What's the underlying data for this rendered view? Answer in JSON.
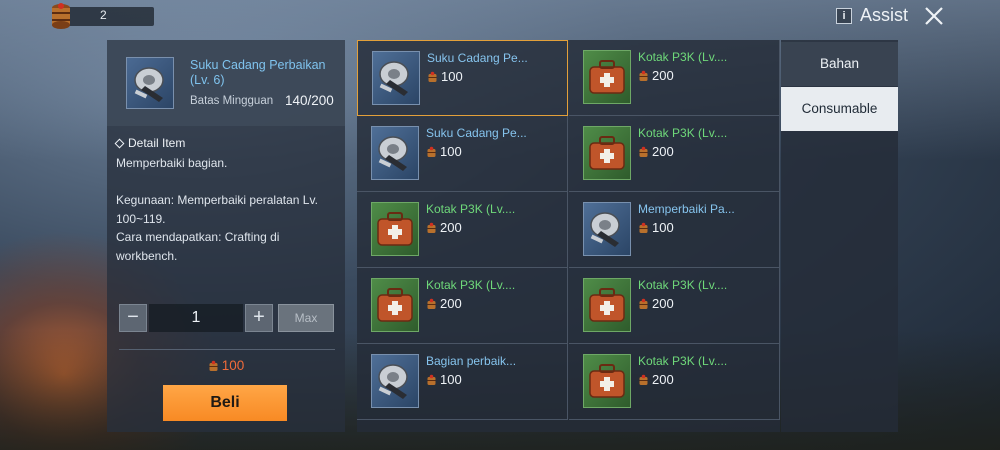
{
  "topbar": {
    "currency_count": "2",
    "currency_icon": "barrel-icon",
    "info_label": "i",
    "assist_label": "Assist",
    "close_icon": "close-icon"
  },
  "detail": {
    "item_name": "Suku Cadang Perbaikan (Lv. 6)",
    "limit_label": "Batas Mingguan",
    "limit_value": "140/200",
    "title": "Detail Item",
    "line1": "Memperbaiki bagian.",
    "line2": "Kegunaan: Memperbaiki peralatan Lv. 100~119.",
    "line3": "Cara mendapatkan: Crafting di workbench.",
    "quantity": "1",
    "minus_label": "−",
    "plus_label": "+",
    "max_label": "Max",
    "price": "100",
    "buy_label": "Beli"
  },
  "grid": {
    "items": [
      {
        "name": "Suku Cadang Pe...",
        "price": "100",
        "icon": "repair-parts-icon",
        "color": "blue",
        "selected": true
      },
      {
        "name": "Kotak P3K (Lv....",
        "price": "200",
        "icon": "first-aid-kit-icon",
        "color": "green"
      },
      {
        "name": "Suku Cadang Pe...",
        "price": "100",
        "icon": "repair-parts-icon",
        "color": "blue"
      },
      {
        "name": "Kotak P3K (Lv....",
        "price": "200",
        "icon": "first-aid-kit-icon",
        "color": "green"
      },
      {
        "name": "Kotak P3K (Lv....",
        "price": "200",
        "icon": "first-aid-kit-icon",
        "color": "green"
      },
      {
        "name": "Memperbaiki Pa...",
        "price": "100",
        "icon": "repair-parts-icon",
        "color": "blue"
      },
      {
        "name": "Kotak P3K (Lv....",
        "price": "200",
        "icon": "first-aid-kit-icon",
        "color": "green"
      },
      {
        "name": "Kotak P3K (Lv....",
        "price": "200",
        "icon": "first-aid-kit-icon",
        "color": "green"
      },
      {
        "name": "Bagian perbaik...",
        "price": "100",
        "icon": "repair-parts-icon",
        "color": "blue"
      },
      {
        "name": "Kotak P3K (Lv....",
        "price": "200",
        "icon": "first-aid-kit-icon",
        "color": "green"
      }
    ]
  },
  "tabs": {
    "bahan": "Bahan",
    "consumable": "Consumable"
  },
  "colors": {
    "accent_orange": "#f88a24",
    "price_red": "#f06b3a",
    "name_blue": "#86c4ee",
    "name_green": "#6fd97a"
  }
}
